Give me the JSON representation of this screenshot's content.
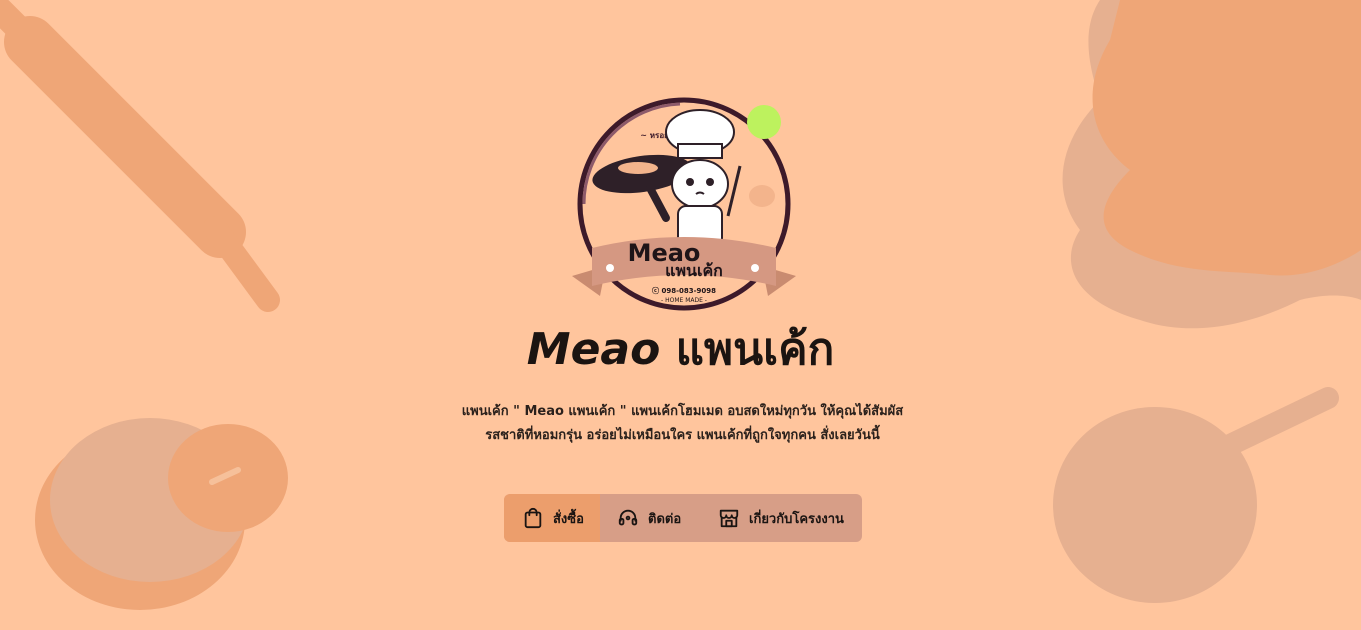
{
  "brand": {
    "title_latin": "Meao",
    "title_thai": "แพนเค้ก",
    "logo": {
      "arc_text": "~ หรอย ถึกิม แพนเค้ก ~",
      "name_latin": "Meao",
      "name_thai": "แพนเค้ก",
      "phone": "ⓒ 098-083-9098",
      "tagline": "- HOME MADE -"
    }
  },
  "description": "แพนเค้ก \" Meao แพนเค้ก \" แพนเค้กโฮมเมด อบสดใหม่ทุกวัน ให้คุณได้สัมผัสรสชาติที่หอมกรุ่น อร่อยไม่เหมือนใคร แพนเค้กที่ถูกใจทุกคน สั่งเลยวันนี้",
  "nav": {
    "order_label": "สั่งซื้อ",
    "contact_label": "ติดต่อ",
    "about_label": "เกี่ยวกับโครงงาน"
  },
  "icons": {
    "order": "shopping-bag-icon",
    "contact": "headset-icon",
    "about": "storefront-icon"
  },
  "colors": {
    "background": "#ffc59d",
    "active_button": "#ec9e6c",
    "button_group": "#d79e87",
    "text": "#1b1411"
  }
}
